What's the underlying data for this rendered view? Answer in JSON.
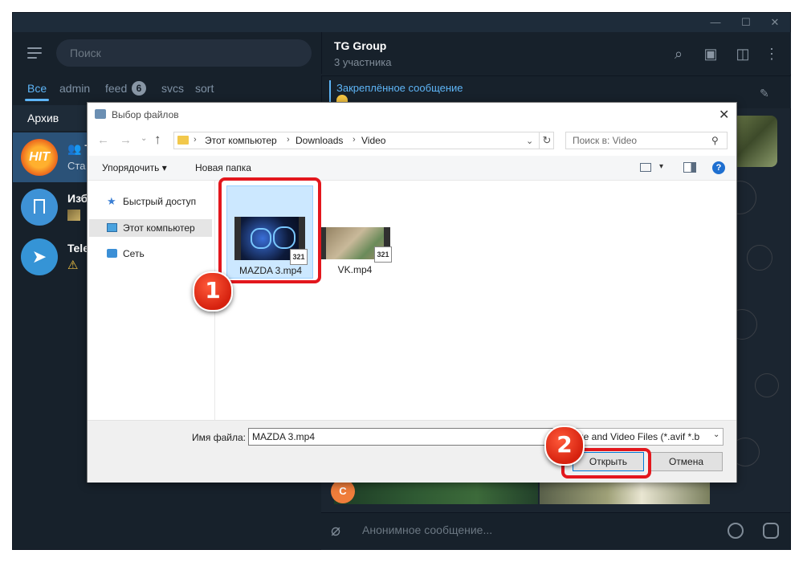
{
  "telegram": {
    "search_placeholder": "Поиск",
    "folder_tabs": [
      {
        "label": "Все"
      },
      {
        "label": "admin"
      },
      {
        "label": "feed",
        "badge": "6"
      },
      {
        "label": "svcs"
      },
      {
        "label": "sort"
      }
    ],
    "archive_label": "Архив",
    "chats": [
      {
        "avatar_text": "HIT",
        "name": "T",
        "sub": "Ста"
      },
      {
        "name": "Изб",
        "sub": ""
      },
      {
        "name": "Tele",
        "sub": ""
      }
    ],
    "chat_title": "TG Group",
    "chat_members": "3 участника",
    "pinned_title": "Закреплённое сообщение",
    "sender_initial": "C",
    "message_placeholder": "Анонимное сообщение...",
    "colors": {
      "accent": "#5eb5f7",
      "background": "#17212b"
    }
  },
  "dialog": {
    "title": "Выбор файлов",
    "address": [
      "Этот компьютер",
      "Downloads",
      "Video"
    ],
    "search_placeholder": "Поиск в: Video",
    "toolbar": {
      "organize": "Упорядочить",
      "new_folder": "Новая папка"
    },
    "nav": [
      {
        "label": "Быстрый доступ",
        "icon": "star-icon"
      },
      {
        "label": "Этот компьютер",
        "icon": "computer-icon",
        "selected": true
      },
      {
        "label": "Сеть",
        "icon": "network-icon"
      }
    ],
    "files": [
      {
        "name": "MAZDA 3.mp4",
        "selected": true
      },
      {
        "name": "VK.mp4",
        "selected": false
      }
    ],
    "filename_label": "Имя файла:",
    "filename_value": "MAZDA 3.mp4",
    "filter_value": "Image and Video Files (*.avif *.b",
    "open_label": "Открыть",
    "cancel_label": "Отмена"
  },
  "annotations": {
    "step1": "1",
    "step2": "2",
    "color": "#e3171d"
  }
}
